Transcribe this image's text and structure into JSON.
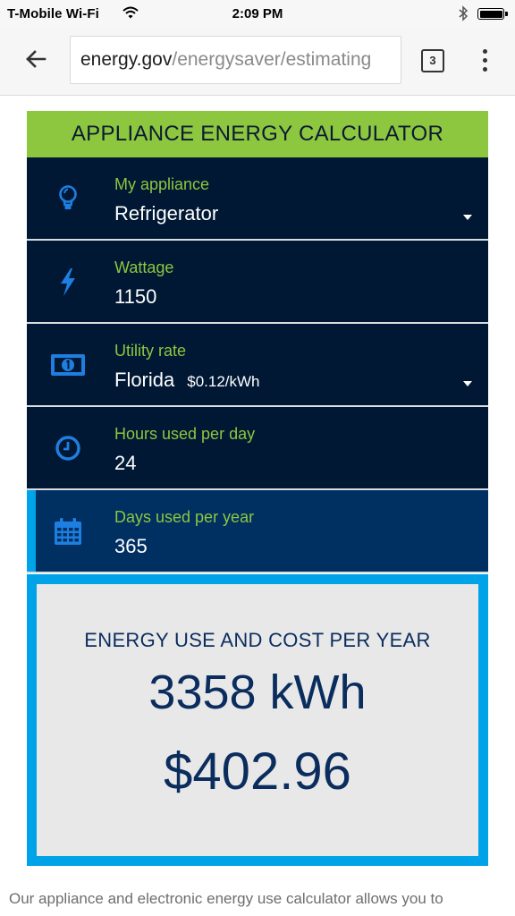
{
  "status_bar": {
    "carrier": "T-Mobile Wi-Fi",
    "time": "2:09 PM",
    "battery_level": 1.0
  },
  "browser": {
    "url_host": "energy.gov",
    "url_path": "/energysaver/estimating",
    "tab_count": "3"
  },
  "calculator": {
    "title": "APPLIANCE ENERGY CALCULATOR",
    "accent_color": "#8dc63f",
    "fields": {
      "appliance": {
        "label": "My appliance",
        "value": "Refrigerator",
        "icon": "lightbulb-icon"
      },
      "wattage": {
        "label": "Wattage",
        "value": "1150",
        "icon": "lightning-icon"
      },
      "utility": {
        "label": "Utility rate",
        "value": "Florida",
        "rate": "$0.12/kWh",
        "icon": "money-icon"
      },
      "hours": {
        "label": "Hours used per day",
        "value": "24",
        "icon": "clock-icon"
      },
      "days": {
        "label": "Days used per year",
        "value": "365",
        "icon": "calendar-icon"
      }
    }
  },
  "result": {
    "heading": "ENERGY USE AND COST PER YEAR",
    "energy": "3358 kWh",
    "cost": "$402.96"
  },
  "description": "Our appliance and electronic energy use calculator allows you to"
}
